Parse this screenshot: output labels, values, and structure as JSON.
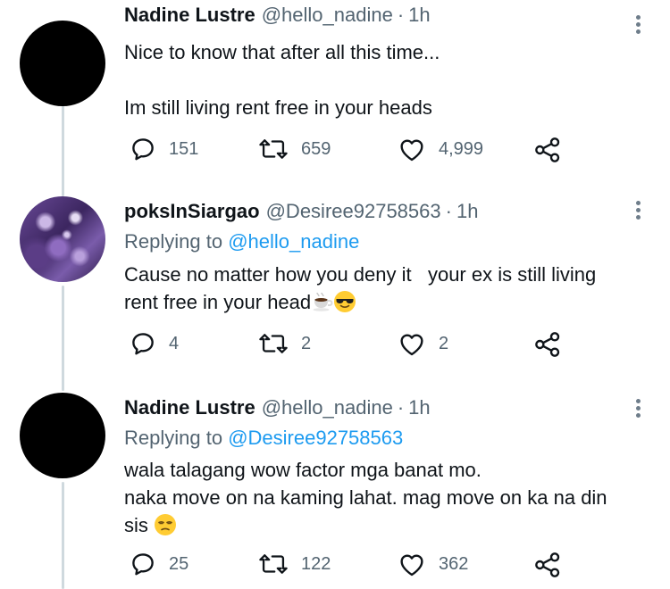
{
  "tweets": [
    {
      "name": "Nadine Lustre",
      "handle": "@hello_nadine",
      "sep": "·",
      "time": "1h",
      "replying_prefix": "",
      "replying_mention": "",
      "lines": [
        "Nice to know that after all this time...",
        "",
        "Im still living rent free in your heads"
      ],
      "replies": "151",
      "retweets": "659",
      "likes": "4,999",
      "avatar": "black-circle"
    },
    {
      "name": "poksInSiargao",
      "handle": "@Desiree92758563",
      "sep": "·",
      "time": "1h",
      "replying_prefix": "Replying to",
      "replying_mention": "@hello_nadine",
      "lines": [
        "Cause no matter how you deny it   your ex is still living",
        "rent free in your head"
      ],
      "emojis": [
        "hot-beverage-emoji",
        "smiling-face-with-sunglasses-emoji"
      ],
      "replies": "4",
      "retweets": "2",
      "likes": "2",
      "avatar": "amethyst-crystal"
    },
    {
      "name": "Nadine Lustre",
      "handle": "@hello_nadine",
      "sep": "·",
      "time": "1h",
      "replying_prefix": "Replying to",
      "replying_mention": "@Desiree92758563",
      "lines": [
        "wala talagang wow factor mga banat mo.",
        "naka move on na kaming lahat. mag move on ka na din",
        "sis"
      ],
      "emojis": [
        "unamused-face-emoji"
      ],
      "replies": "25",
      "retweets": "122",
      "likes": "362",
      "avatar": "black-circle"
    }
  ],
  "icons": [
    "reply-icon",
    "retweet-icon",
    "like-icon",
    "share-icon",
    "more-options-icon"
  ],
  "colors": {
    "text": "#0f1419",
    "muted": "#536471",
    "link": "#1d9bf0",
    "thread_line": "#cfd9de"
  }
}
